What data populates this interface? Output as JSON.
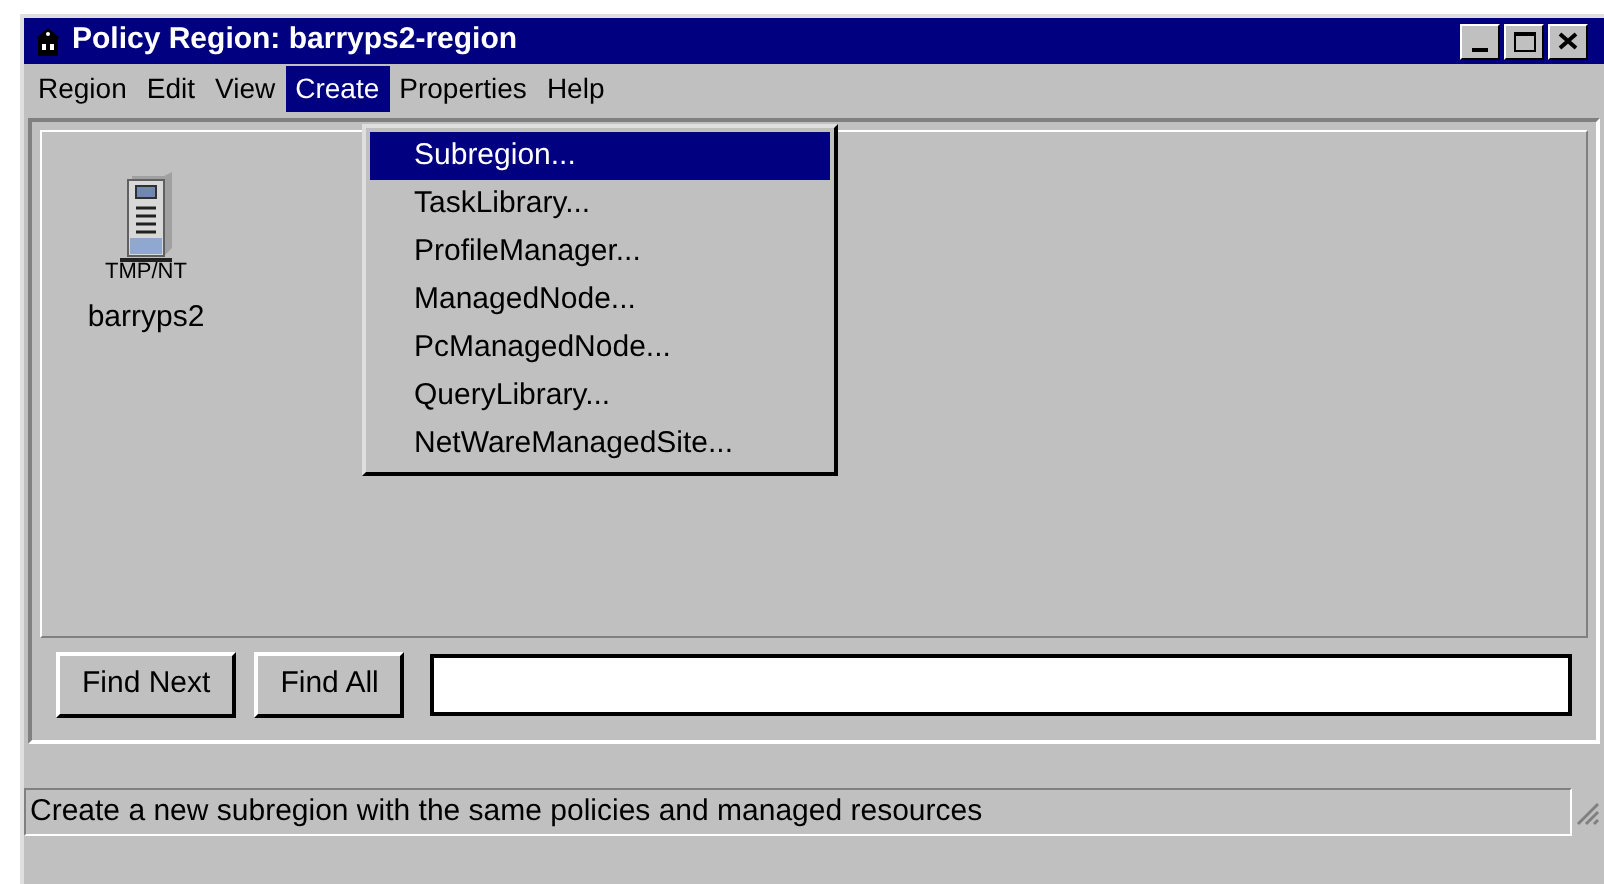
{
  "window": {
    "title": "Policy Region: barryps2-region"
  },
  "menu_bar": [
    {
      "label": "Region",
      "selected": false
    },
    {
      "label": "Edit",
      "selected": false
    },
    {
      "label": "View",
      "selected": false
    },
    {
      "label": "Create",
      "selected": true
    },
    {
      "label": "Properties",
      "selected": false
    },
    {
      "label": "Help",
      "selected": false
    }
  ],
  "dropdown": [
    {
      "label": "Subregion...",
      "selected": true
    },
    {
      "label": "TaskLibrary...",
      "selected": false
    },
    {
      "label": "ProfileManager...",
      "selected": false
    },
    {
      "label": "ManagedNode...",
      "selected": false
    },
    {
      "label": "PcManagedNode...",
      "selected": false
    },
    {
      "label": "QueryLibrary...",
      "selected": false
    },
    {
      "label": "NetWareManagedSite...",
      "selected": false
    }
  ],
  "icons": [
    {
      "badge": "TMP/NT",
      "label": "barryps2"
    }
  ],
  "find_bar": {
    "buttons": [
      "Find Next",
      "Find All"
    ]
  },
  "status_bar": "Create a new subregion with the same policies and managed resources"
}
